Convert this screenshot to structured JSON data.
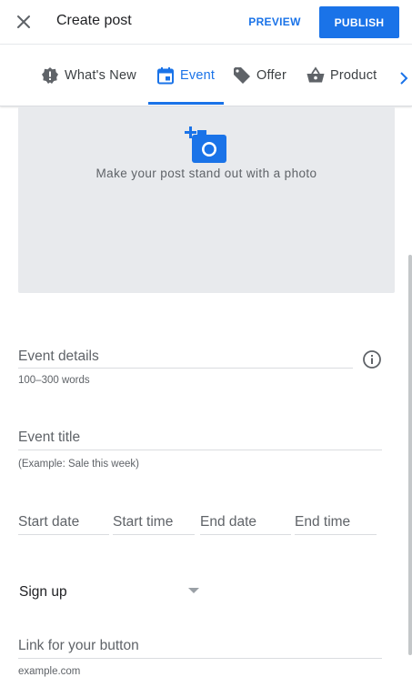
{
  "header": {
    "title": "Create post",
    "preview_label": "PREVIEW",
    "publish_label": "PUBLISH"
  },
  "tabs": [
    {
      "label": "What's New",
      "icon": "alert-badge-icon",
      "active": false
    },
    {
      "label": "Event",
      "icon": "calendar-icon",
      "active": true
    },
    {
      "label": "Offer",
      "icon": "tag-icon",
      "active": false
    },
    {
      "label": "Product",
      "icon": "shopping-basket-icon",
      "active": false
    }
  ],
  "photo": {
    "label": "Make your post stand out with a photo",
    "icon": "add-photo-icon"
  },
  "form": {
    "event_details_placeholder": "Event details",
    "event_details_helper": "100–300 words",
    "event_title_placeholder": "Event title",
    "event_title_helper": "(Example: Sale this week)",
    "start_date_placeholder": "Start date",
    "start_time_placeholder": "Start time",
    "end_date_placeholder": "End date",
    "end_time_placeholder": "End time",
    "button_type_value": "Sign up",
    "link_placeholder": "Link for your button",
    "link_helper": "example.com"
  },
  "colors": {
    "accent": "#1a73e8",
    "photo_bg": "#e8eaed"
  }
}
